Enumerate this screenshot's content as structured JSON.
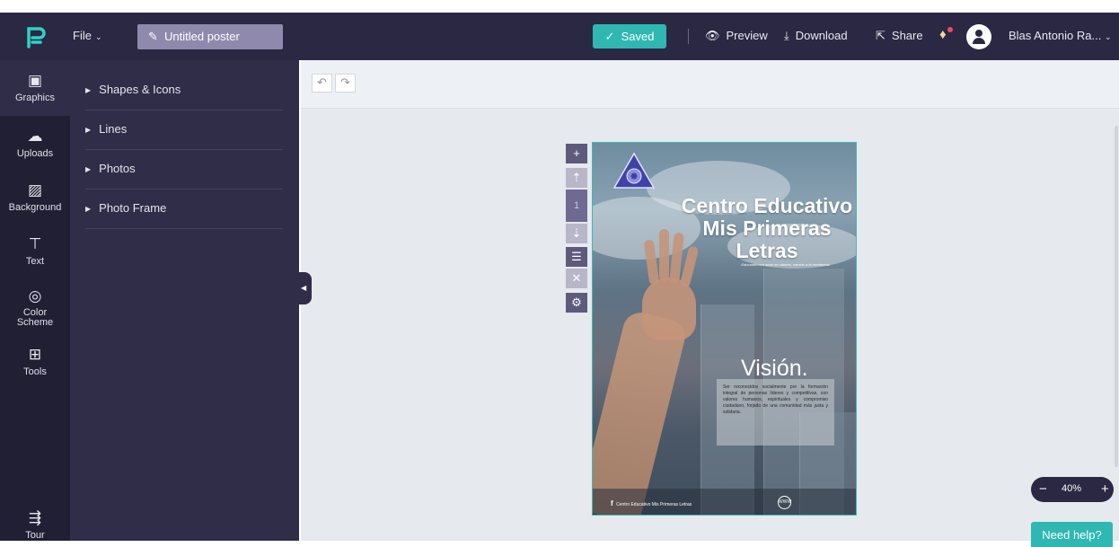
{
  "header": {
    "file_menu": "File",
    "title_value": "Untitled poster",
    "saved_label": "Saved",
    "preview_label": "Preview",
    "download_label": "Download",
    "share_label": "Share",
    "user_name": "Blas Antonio Ra..."
  },
  "nav": {
    "items": [
      {
        "label": "Graphics",
        "icon": "image-icon"
      },
      {
        "label": "Uploads",
        "icon": "cloud-upload-icon"
      },
      {
        "label": "Background",
        "icon": "pattern-icon"
      },
      {
        "label": "Text",
        "icon": "text-icon"
      },
      {
        "label": "Color Scheme",
        "icon": "palette-icon"
      },
      {
        "label": "Tools",
        "icon": "toolbox-icon"
      },
      {
        "label": "Tour",
        "icon": "signpost-icon"
      }
    ]
  },
  "panel": {
    "items": [
      {
        "label": "Shapes & Icons"
      },
      {
        "label": "Lines"
      },
      {
        "label": "Photos"
      },
      {
        "label": "Photo Frame"
      }
    ]
  },
  "page_tools": {
    "page_number": "1"
  },
  "poster": {
    "title": "Centro Educativo Mis Primeras Letras",
    "tagline": "Educando con amor en valores, camino a la excelencia.",
    "vision_heading": "Visión.",
    "vision_text": "Ser reconocidos socialmente por la formación integral de personas líderes y competitivas, con valores humanos, espirituales y compromiso ciudadano, forjado de una comunidad más justa y solidaria.",
    "footer_social": "Centro Educativo Mis Primeras Letras",
    "footer_web_icon": "WWW"
  },
  "zoom": {
    "value": "40%"
  },
  "help": {
    "label": "Need help?"
  },
  "colors": {
    "topbar": "#2a2842",
    "accent": "#2fb8b2",
    "sidebar": "#211f33",
    "panel": "#2f2d47"
  }
}
